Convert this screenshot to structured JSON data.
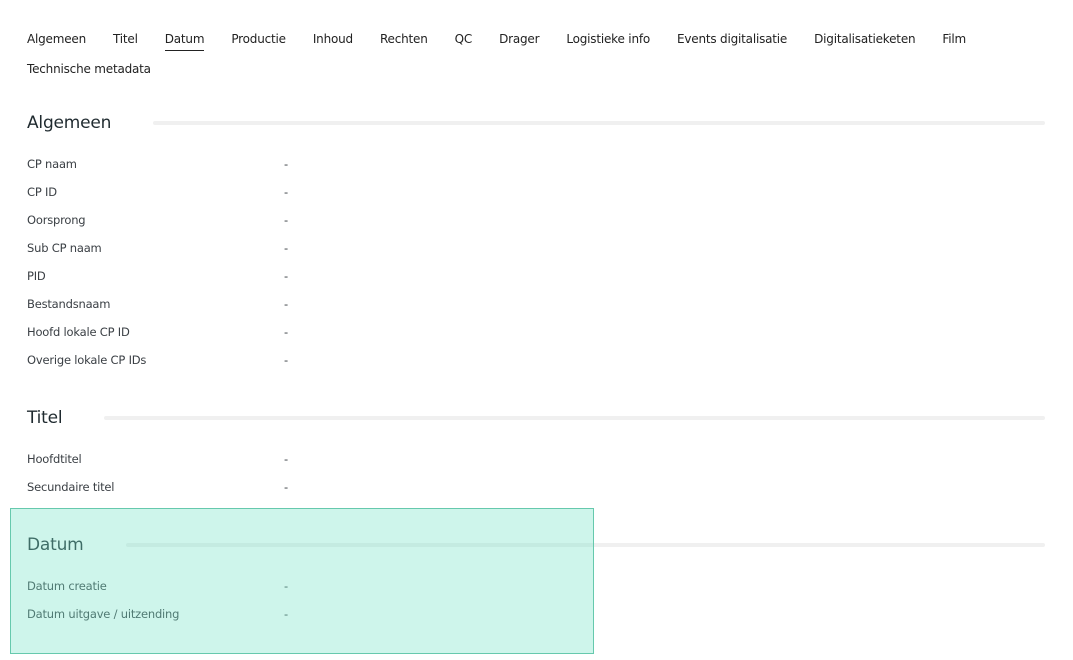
{
  "tabs": [
    {
      "label": "Algemeen",
      "active": false
    },
    {
      "label": "Titel",
      "active": false
    },
    {
      "label": "Datum",
      "active": true
    },
    {
      "label": "Productie",
      "active": false
    },
    {
      "label": "Inhoud",
      "active": false
    },
    {
      "label": "Rechten",
      "active": false
    },
    {
      "label": "QC",
      "active": false
    },
    {
      "label": "Drager",
      "active": false
    },
    {
      "label": "Logistieke info",
      "active": false
    },
    {
      "label": "Events digitalisatie",
      "active": false
    },
    {
      "label": "Digitalisatieketen",
      "active": false
    },
    {
      "label": "Film",
      "active": false
    },
    {
      "label": "Technische metadata",
      "active": false
    }
  ],
  "sections": {
    "algemeen": {
      "title": "Algemeen",
      "rows": [
        {
          "label": "CP naam",
          "value": "-"
        },
        {
          "label": "CP ID",
          "value": "-"
        },
        {
          "label": "Oorsprong",
          "value": "-"
        },
        {
          "label": "Sub CP naam",
          "value": "-"
        },
        {
          "label": "PID",
          "value": "-"
        },
        {
          "label": "Bestandsnaam",
          "value": "-"
        },
        {
          "label": "Hoofd lokale CP ID",
          "value": "-"
        },
        {
          "label": "Overige lokale CP IDs",
          "value": "-"
        }
      ]
    },
    "titel": {
      "title": "Titel",
      "rows": [
        {
          "label": "Hoofdtitel",
          "value": "-"
        },
        {
          "label": "Secundaire titel",
          "value": "-"
        }
      ]
    },
    "datum": {
      "title": "Datum",
      "rows": [
        {
          "label": "Datum creatie",
          "value": "-"
        },
        {
          "label": "Datum uitgave / uitzending",
          "value": "-"
        }
      ]
    }
  },
  "colors": {
    "highlight_fill": "#76e2c8",
    "highlight_border": "#66c9ad",
    "rule": "#f0f0f0"
  }
}
